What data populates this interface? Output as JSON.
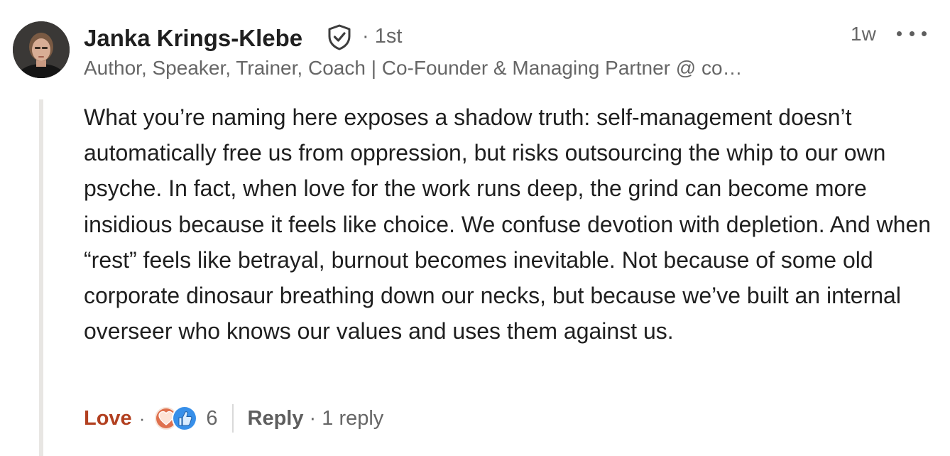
{
  "comment": {
    "author": {
      "name": "Janka Krings-Klebe",
      "connection": "· 1st",
      "headline": "Author, Speaker, Trainer, Coach | Co-Founder & Managing Partner @ co…",
      "avatar_icon": "person-portrait"
    },
    "timestamp": "1w",
    "more_icon": "ellipsis-icon",
    "verified_icon": "verified-shield-icon",
    "body": "What you’re naming here exposes a shadow truth: self-management doesn’t automatically free us from oppression, but risks outsourcing the whip to our own psyche. In fact, when love for the work runs deep, the grind can become more insidious because it feels like choice. We confuse devotion with depletion. And when “rest” feels like betrayal, burnout becomes inevitable. Not because of some old corporate dinosaur breathing down our necks, but because we’ve built an internal overseer who knows our values and uses them against us.",
    "actions": {
      "reaction_label": "Love",
      "separator": "·",
      "reaction_icons": [
        "love-heart-icon",
        "like-thumb-icon"
      ],
      "reaction_count": "6",
      "reply_label": "Reply",
      "reply_count": "· 1 reply"
    },
    "colors": {
      "love_accent": "#b24020",
      "like_blue": "#378fe9",
      "love_orange": "#df704d"
    }
  }
}
